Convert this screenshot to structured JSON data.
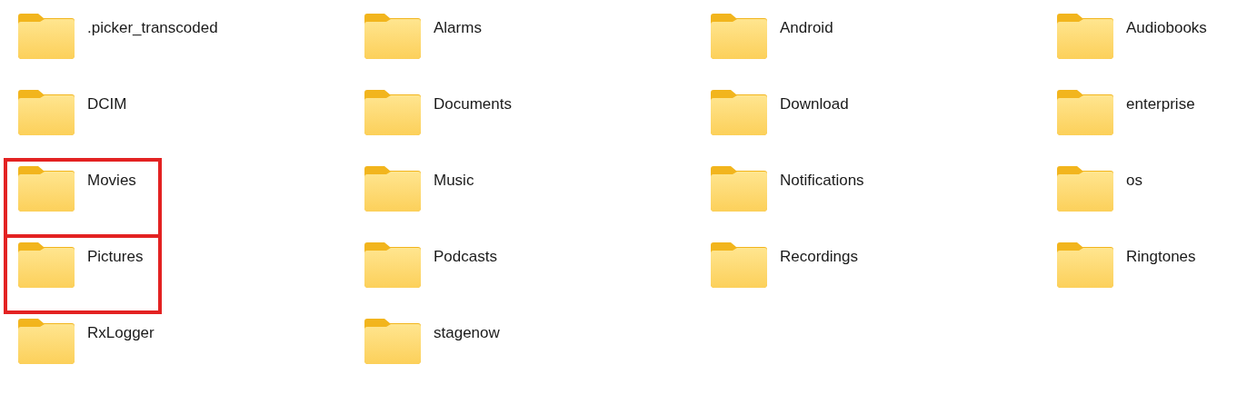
{
  "folders": [
    {
      "name": ".picker_transcoded",
      "highlighted": false
    },
    {
      "name": "Alarms",
      "highlighted": false
    },
    {
      "name": "Android",
      "highlighted": false
    },
    {
      "name": "Audiobooks",
      "highlighted": false
    },
    {
      "name": "DCIM",
      "highlighted": false
    },
    {
      "name": "Documents",
      "highlighted": false
    },
    {
      "name": "Download",
      "highlighted": false
    },
    {
      "name": "enterprise",
      "highlighted": false
    },
    {
      "name": "Movies",
      "highlighted": true
    },
    {
      "name": "Music",
      "highlighted": false
    },
    {
      "name": "Notifications",
      "highlighted": false
    },
    {
      "name": "os",
      "highlighted": false
    },
    {
      "name": "Pictures",
      "highlighted": true
    },
    {
      "name": "Podcasts",
      "highlighted": false
    },
    {
      "name": "Recordings",
      "highlighted": false
    },
    {
      "name": "Ringtones",
      "highlighted": false
    },
    {
      "name": "RxLogger",
      "highlighted": false
    },
    {
      "name": "stagenow",
      "highlighted": false
    }
  ]
}
